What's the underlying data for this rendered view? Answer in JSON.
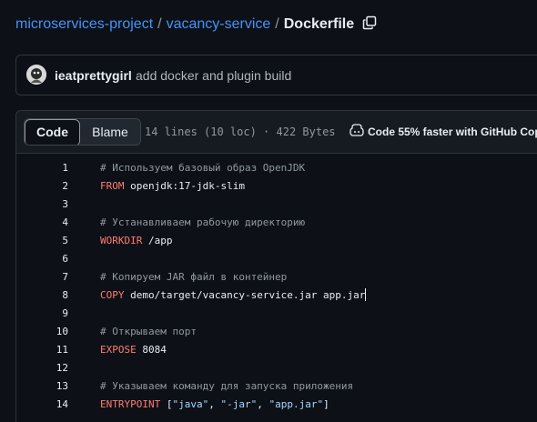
{
  "breadcrumb": {
    "repo": "microservices-project",
    "separator": "/",
    "folder": "vacancy-service",
    "file": "Dockerfile"
  },
  "commit": {
    "author": "ieatprettygirl",
    "message": "add docker and plugin build"
  },
  "file_header": {
    "tabs": [
      "Code",
      "Blame"
    ],
    "active_tab": "Code",
    "meta": "14 lines (10 loc) · 422 Bytes",
    "copilot_text": "Code 55% faster with GitHub Copi"
  },
  "code_lines": [
    {
      "n": "1",
      "comment": "# Используем базовый образ OpenJDK"
    },
    {
      "n": "2",
      "kw": "FROM",
      "rest": " openjdk:17-jdk-slim"
    },
    {
      "n": "3"
    },
    {
      "n": "4",
      "comment": "# Устанавливаем рабочую директорию"
    },
    {
      "n": "5",
      "kw": "WORKDIR",
      "rest": " /app"
    },
    {
      "n": "6"
    },
    {
      "n": "7",
      "comment": "# Копируем JAR файл в контейнер"
    },
    {
      "n": "8",
      "kw": "COPY",
      "rest": " demo/target/vacancy-service.jar app.jar"
    },
    {
      "n": "9"
    },
    {
      "n": "10",
      "comment": "# Открываем порт"
    },
    {
      "n": "11",
      "kw": "EXPOSE",
      "rest": " 8084"
    },
    {
      "n": "12"
    },
    {
      "n": "13",
      "comment": "# Указываем команду для запуска приложения"
    },
    {
      "n": "14",
      "kw": "ENTRYPOINT",
      "rest_parts": [
        " [",
        "\"java\"",
        ", ",
        "\"-jar\"",
        ", ",
        "\"app.jar\"",
        "]"
      ]
    }
  ],
  "colors": {
    "link": "#4493f8",
    "keyword": "#ff7b72",
    "comment": "#9198a1",
    "string": "#a5d6ff",
    "background": "#0d1117"
  },
  "icons": {
    "copy": "copy-icon",
    "copilot": "copilot-icon",
    "avatar": "avatar"
  }
}
